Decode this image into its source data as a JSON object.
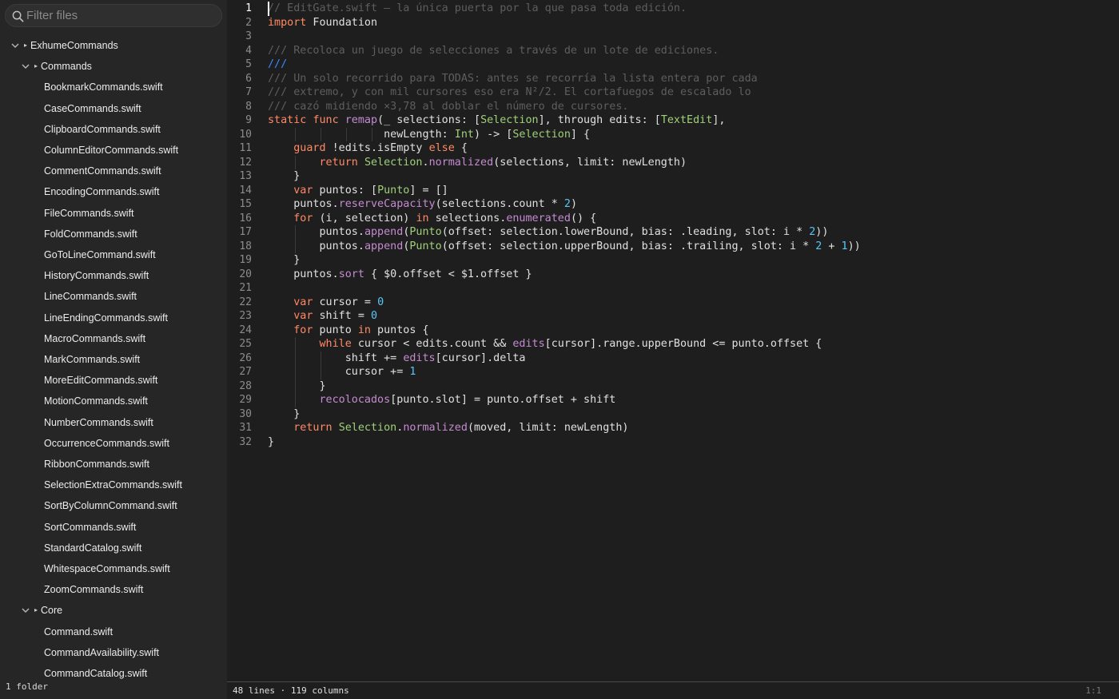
{
  "sidebar": {
    "filter_placeholder": "Filter files",
    "status": "1 folder",
    "tree": [
      {
        "label": "ExhumeCommands",
        "kind": "folder",
        "depth": 0
      },
      {
        "label": "Commands",
        "kind": "folder",
        "depth": 1
      },
      {
        "label": "BookmarkCommands.swift",
        "kind": "file",
        "depth": 2
      },
      {
        "label": "CaseCommands.swift",
        "kind": "file",
        "depth": 2
      },
      {
        "label": "ClipboardCommands.swift",
        "kind": "file",
        "depth": 2
      },
      {
        "label": "ColumnEditorCommands.swift",
        "kind": "file",
        "depth": 2
      },
      {
        "label": "CommentCommands.swift",
        "kind": "file",
        "depth": 2
      },
      {
        "label": "EncodingCommands.swift",
        "kind": "file",
        "depth": 2
      },
      {
        "label": "FileCommands.swift",
        "kind": "file",
        "depth": 2
      },
      {
        "label": "FoldCommands.swift",
        "kind": "file",
        "depth": 2
      },
      {
        "label": "GoToLineCommand.swift",
        "kind": "file",
        "depth": 2
      },
      {
        "label": "HistoryCommands.swift",
        "kind": "file",
        "depth": 2
      },
      {
        "label": "LineCommands.swift",
        "kind": "file",
        "depth": 2
      },
      {
        "label": "LineEndingCommands.swift",
        "kind": "file",
        "depth": 2
      },
      {
        "label": "MacroCommands.swift",
        "kind": "file",
        "depth": 2
      },
      {
        "label": "MarkCommands.swift",
        "kind": "file",
        "depth": 2
      },
      {
        "label": "MoreEditCommands.swift",
        "kind": "file",
        "depth": 2
      },
      {
        "label": "MotionCommands.swift",
        "kind": "file",
        "depth": 2
      },
      {
        "label": "NumberCommands.swift",
        "kind": "file",
        "depth": 2
      },
      {
        "label": "OccurrenceCommands.swift",
        "kind": "file",
        "depth": 2
      },
      {
        "label": "RibbonCommands.swift",
        "kind": "file",
        "depth": 2
      },
      {
        "label": "SelectionExtraCommands.swift",
        "kind": "file",
        "depth": 2
      },
      {
        "label": "SortByColumnCommand.swift",
        "kind": "file",
        "depth": 2
      },
      {
        "label": "SortCommands.swift",
        "kind": "file",
        "depth": 2
      },
      {
        "label": "StandardCatalog.swift",
        "kind": "file",
        "depth": 2
      },
      {
        "label": "WhitespaceCommands.swift",
        "kind": "file",
        "depth": 2
      },
      {
        "label": "ZoomCommands.swift",
        "kind": "file",
        "depth": 2
      },
      {
        "label": "Core",
        "kind": "folder",
        "depth": 1
      },
      {
        "label": "Command.swift",
        "kind": "file",
        "depth": 2
      },
      {
        "label": "CommandAvailability.swift",
        "kind": "file",
        "depth": 2
      },
      {
        "label": "CommandCatalog.swift",
        "kind": "file",
        "depth": 2
      }
    ]
  },
  "editor": {
    "current_line": 1,
    "lines": [
      [
        [
          "com",
          "// EditGate.swift — la única puerta por la que pasa toda edición."
        ]
      ],
      [
        [
          "kw",
          "import"
        ],
        [
          "tx",
          " Foundation"
        ]
      ],
      [],
      [
        [
          "com",
          "/// Recoloca un juego de selecciones a través de un lote de ediciones."
        ]
      ],
      [
        [
          "doc",
          "///"
        ]
      ],
      [
        [
          "com",
          "/// Un solo recorrido para TODAS: antes se recorría la lista entera por cada"
        ]
      ],
      [
        [
          "com",
          "/// extremo, y con mil cursores eso era N²/2. El cortafuegos de escalado lo"
        ]
      ],
      [
        [
          "com",
          "/// cazó midiendo ×3,78 al doblar el número de cursores."
        ]
      ],
      [
        [
          "kw",
          "static"
        ],
        [
          "tx",
          " "
        ],
        [
          "kw",
          "func"
        ],
        [
          "tx",
          " "
        ],
        [
          "fn",
          "remap"
        ],
        [
          "tx",
          "(_ selections: ["
        ],
        [
          "ty",
          "Selection"
        ],
        [
          "tx",
          "], through edits: ["
        ],
        [
          "ty",
          "TextEdit"
        ],
        [
          "tx",
          "],"
        ]
      ],
      [
        [
          "tx",
          "                  newLength: "
        ],
        [
          "ty",
          "Int"
        ],
        [
          "tx",
          ") -> ["
        ],
        [
          "ty",
          "Selection"
        ],
        [
          "tx",
          "] {"
        ]
      ],
      [
        [
          "tx",
          "    "
        ],
        [
          "kw",
          "guard"
        ],
        [
          "tx",
          " !edits.isEmpty "
        ],
        [
          "kw",
          "else"
        ],
        [
          "tx",
          " {"
        ]
      ],
      [
        [
          "tx",
          "        "
        ],
        [
          "kw",
          "return"
        ],
        [
          "tx",
          " "
        ],
        [
          "ty",
          "Selection"
        ],
        [
          "tx",
          "."
        ],
        [
          "fn",
          "normalized"
        ],
        [
          "tx",
          "(selections, limit: newLength)"
        ]
      ],
      [
        [
          "tx",
          "    }"
        ]
      ],
      [
        [
          "tx",
          "    "
        ],
        [
          "kw",
          "var"
        ],
        [
          "tx",
          " puntos: ["
        ],
        [
          "ty",
          "Punto"
        ],
        [
          "tx",
          "] = []"
        ]
      ],
      [
        [
          "tx",
          "    puntos."
        ],
        [
          "fn",
          "reserveCapacity"
        ],
        [
          "tx",
          "(selections.count * "
        ],
        [
          "num",
          "2"
        ],
        [
          "tx",
          ")"
        ]
      ],
      [
        [
          "tx",
          "    "
        ],
        [
          "kw",
          "for"
        ],
        [
          "tx",
          " (i, selection) "
        ],
        [
          "kw",
          "in"
        ],
        [
          "tx",
          " selections."
        ],
        [
          "fn",
          "enumerated"
        ],
        [
          "tx",
          "() {"
        ]
      ],
      [
        [
          "tx",
          "        puntos."
        ],
        [
          "fn",
          "append"
        ],
        [
          "tx",
          "("
        ],
        [
          "ty",
          "Punto"
        ],
        [
          "tx",
          "(offset: selection.lowerBound, bias: .leading, slot: i * "
        ],
        [
          "num",
          "2"
        ],
        [
          "tx",
          "))"
        ]
      ],
      [
        [
          "tx",
          "        puntos."
        ],
        [
          "fn",
          "append"
        ],
        [
          "tx",
          "("
        ],
        [
          "ty",
          "Punto"
        ],
        [
          "tx",
          "(offset: selection.upperBound, bias: .trailing, slot: i * "
        ],
        [
          "num",
          "2"
        ],
        [
          "tx",
          " + "
        ],
        [
          "num",
          "1"
        ],
        [
          "tx",
          "))"
        ]
      ],
      [
        [
          "tx",
          "    }"
        ]
      ],
      [
        [
          "tx",
          "    puntos."
        ],
        [
          "fn",
          "sort"
        ],
        [
          "tx",
          " { $0.offset < $1.offset }"
        ]
      ],
      [],
      [
        [
          "tx",
          "    "
        ],
        [
          "kw",
          "var"
        ],
        [
          "tx",
          " cursor = "
        ],
        [
          "num",
          "0"
        ]
      ],
      [
        [
          "tx",
          "    "
        ],
        [
          "kw",
          "var"
        ],
        [
          "tx",
          " shift = "
        ],
        [
          "num",
          "0"
        ]
      ],
      [
        [
          "tx",
          "    "
        ],
        [
          "kw",
          "for"
        ],
        [
          "tx",
          " punto "
        ],
        [
          "kw",
          "in"
        ],
        [
          "tx",
          " puntos {"
        ]
      ],
      [
        [
          "tx",
          "        "
        ],
        [
          "kw",
          "while"
        ],
        [
          "tx",
          " cursor < edits.count && "
        ],
        [
          "fn",
          "edits"
        ],
        [
          "tx",
          "[cursor].range.upperBound <= punto.offset {"
        ]
      ],
      [
        [
          "tx",
          "            shift += "
        ],
        [
          "fn",
          "edits"
        ],
        [
          "tx",
          "[cursor].delta"
        ]
      ],
      [
        [
          "tx",
          "            cursor += "
        ],
        [
          "num",
          "1"
        ]
      ],
      [
        [
          "tx",
          "        }"
        ]
      ],
      [
        [
          "tx",
          "        "
        ],
        [
          "fn",
          "recolocados"
        ],
        [
          "tx",
          "[punto.slot] = punto.offset + shift"
        ]
      ],
      [
        [
          "tx",
          "    }"
        ]
      ],
      [
        [
          "tx",
          "    "
        ],
        [
          "kw",
          "return"
        ],
        [
          "tx",
          " "
        ],
        [
          "ty",
          "Selection"
        ],
        [
          "tx",
          "."
        ],
        [
          "fn",
          "normalized"
        ],
        [
          "tx",
          "(moved, limit: newLength)"
        ]
      ],
      [
        [
          "tx",
          "}"
        ]
      ]
    ]
  },
  "status": {
    "summary": "48 lines · 119 columns",
    "position": "1:1"
  }
}
